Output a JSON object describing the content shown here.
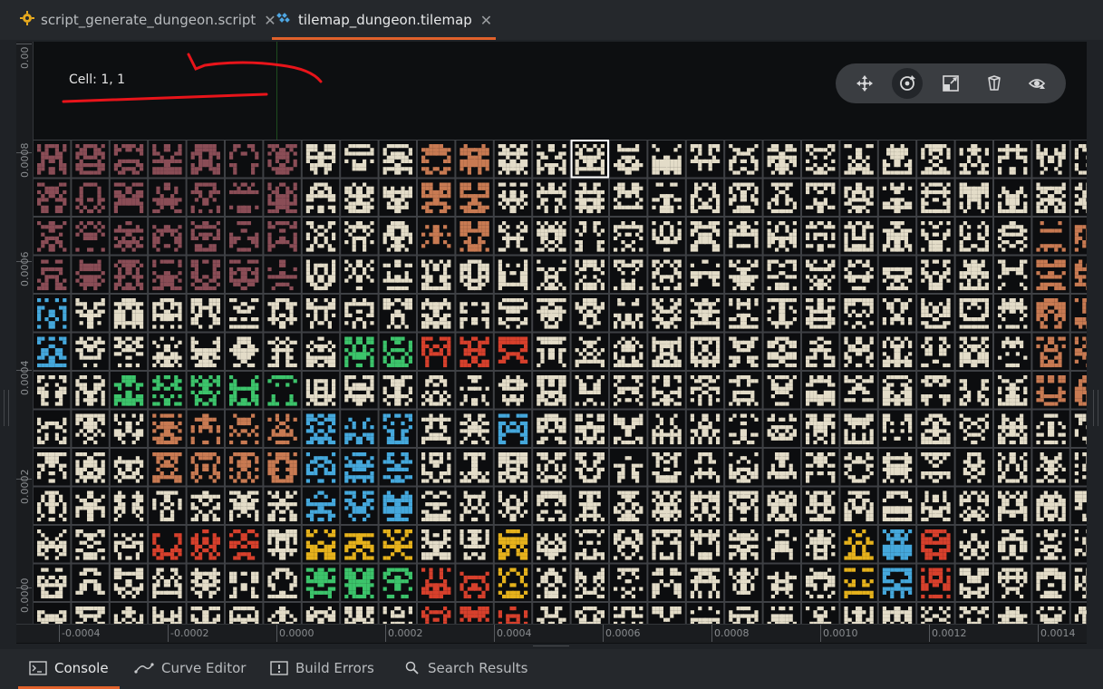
{
  "tabs": [
    {
      "label": "script_generate_dungeon.script",
      "icon": "gear-icon",
      "close": "✕",
      "active": false
    },
    {
      "label": "tilemap_dungeon.tilemap",
      "icon": "tilemap-icon",
      "close": "✕",
      "active": true
    }
  ],
  "editor": {
    "cell_readout": "Cell: 1, 1",
    "ruler_x": [
      "-0.0004",
      "-0.0002",
      "0.0000",
      "0.0002",
      "0.0004",
      "0.0006",
      "0.0008",
      "0.0010",
      "0.0012",
      "0.0014"
    ],
    "ruler_y": [
      "0.00",
      "0.0008",
      "0.0006",
      "0.0004",
      "0.0002",
      "0.0000"
    ],
    "toolbar": [
      {
        "name": "move-tool",
        "icon": "move-icon"
      },
      {
        "name": "rotate-tool",
        "icon": "rotate-icon",
        "selected": true
      },
      {
        "name": "scale-tool",
        "icon": "scale-icon"
      },
      {
        "name": "perspective-tool",
        "icon": "cube-icon"
      },
      {
        "name": "visibility-tool",
        "icon": "eye-icon"
      }
    ],
    "annotation_color": "#e8141a"
  },
  "bottom_tabs": [
    {
      "label": "Console",
      "icon": "terminal-icon",
      "active": true
    },
    {
      "label": "Curve Editor",
      "icon": "curve-icon",
      "active": false
    },
    {
      "label": "Build Errors",
      "icon": "alert-icon",
      "active": false
    },
    {
      "label": "Search Results",
      "icon": "search-icon",
      "active": false
    }
  ],
  "colors": {
    "accent": "#e0612b",
    "grid_line": "#3e4044",
    "tile_cream": "#e3dcc8",
    "tile_brown": "#8a4d56",
    "tile_blue": "#45a8dc",
    "tile_green": "#3cc46b",
    "tile_yellow": "#e6b21c",
    "tile_red": "#d7402c",
    "tile_orange": "#c87a52"
  }
}
